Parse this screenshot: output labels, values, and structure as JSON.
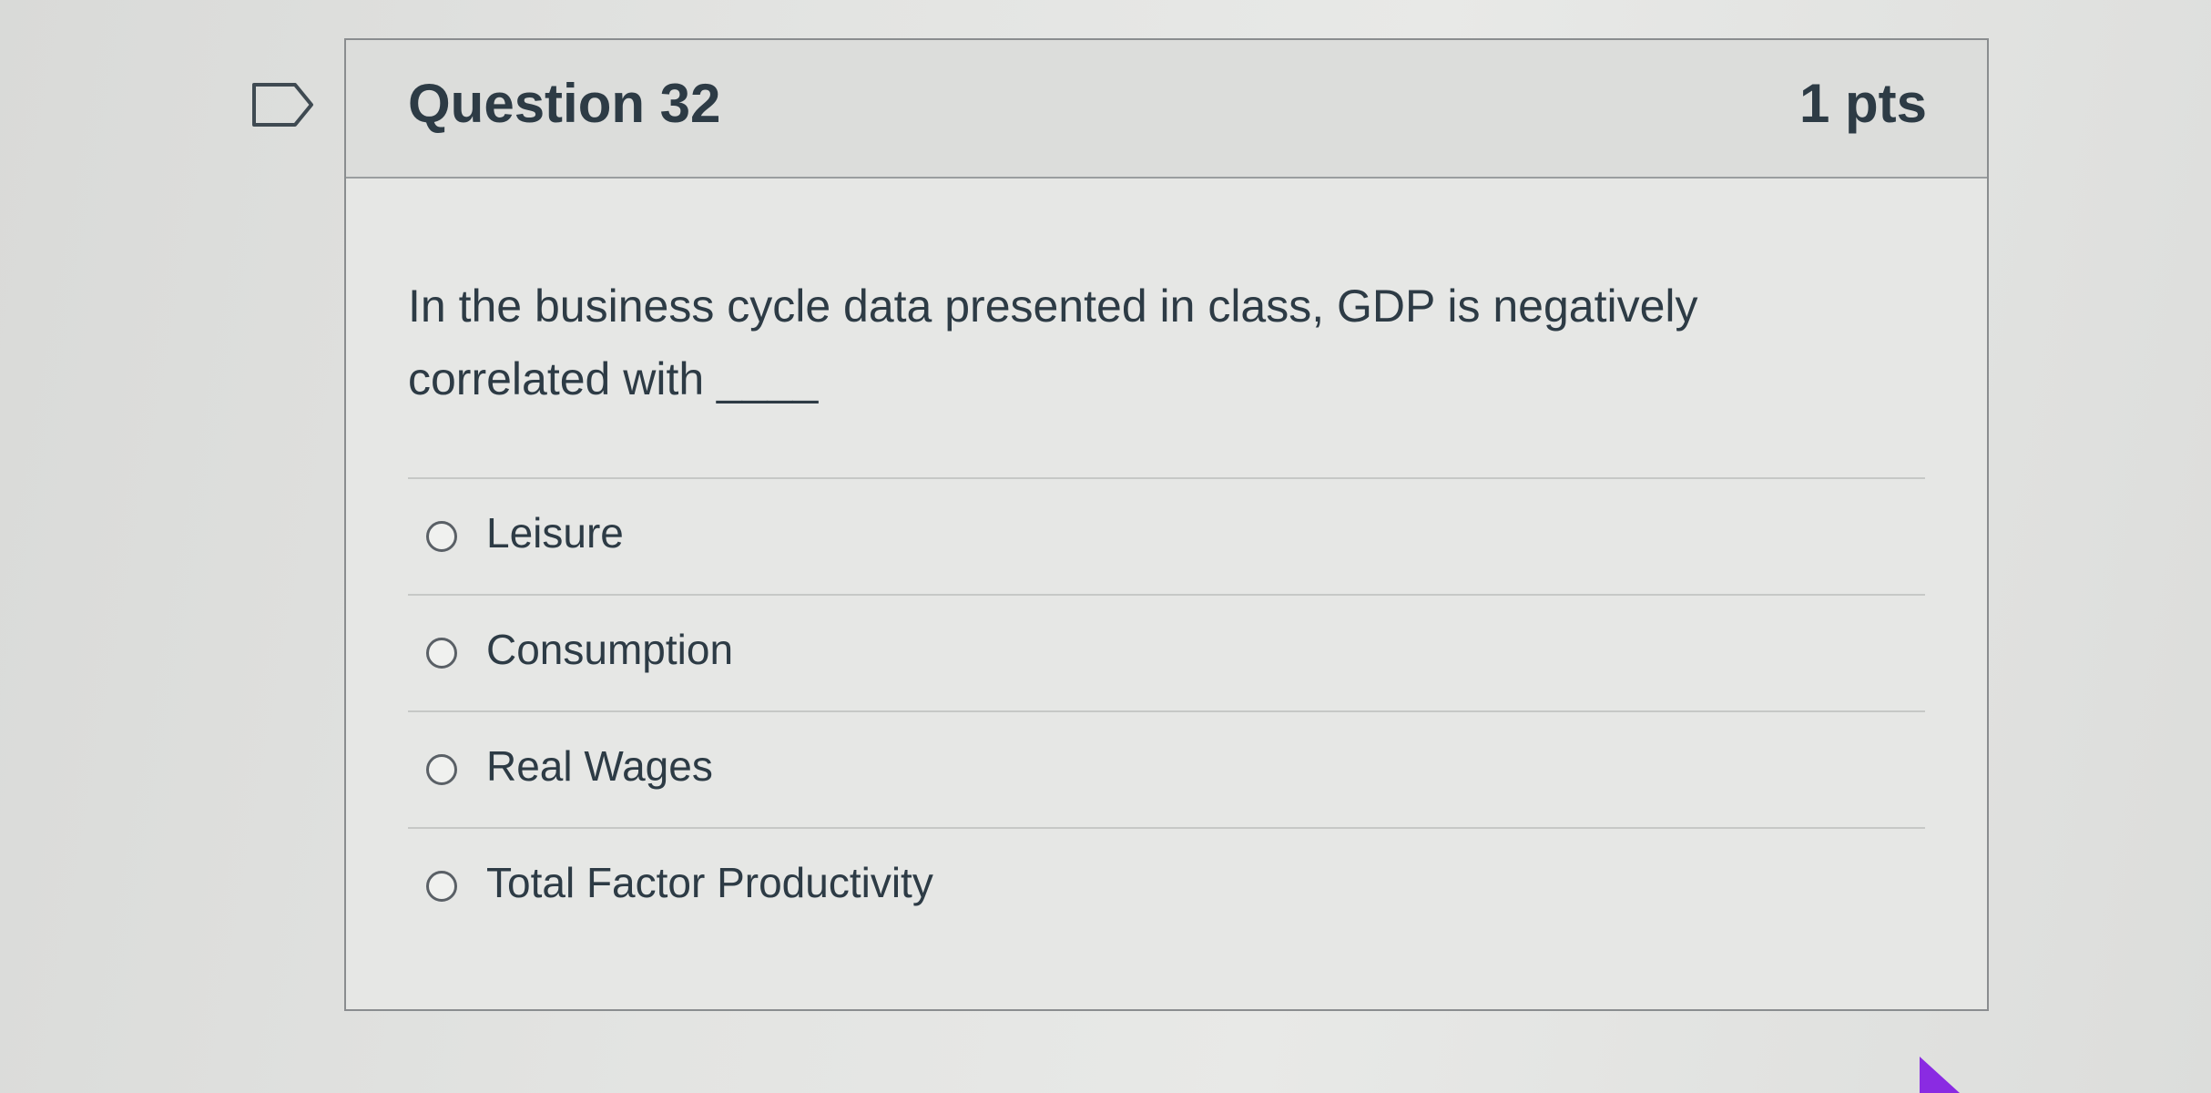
{
  "question": {
    "title": "Question 32",
    "points": "1 pts",
    "text": "In the business cycle data presented in class, GDP is negatively correlated with ____"
  },
  "answers": [
    {
      "label": "Leisure",
      "selected": false
    },
    {
      "label": "Consumption",
      "selected": false
    },
    {
      "label": "Real Wages",
      "selected": false
    },
    {
      "label": "Total Factor Productivity",
      "selected": false
    }
  ],
  "icons": {
    "flag": "flag-question-icon",
    "cursor": "mouse-pointer-icon"
  },
  "colors": {
    "text": "#2d3b45",
    "border": "#8a8d8f",
    "cursor": "#8a2be2"
  }
}
